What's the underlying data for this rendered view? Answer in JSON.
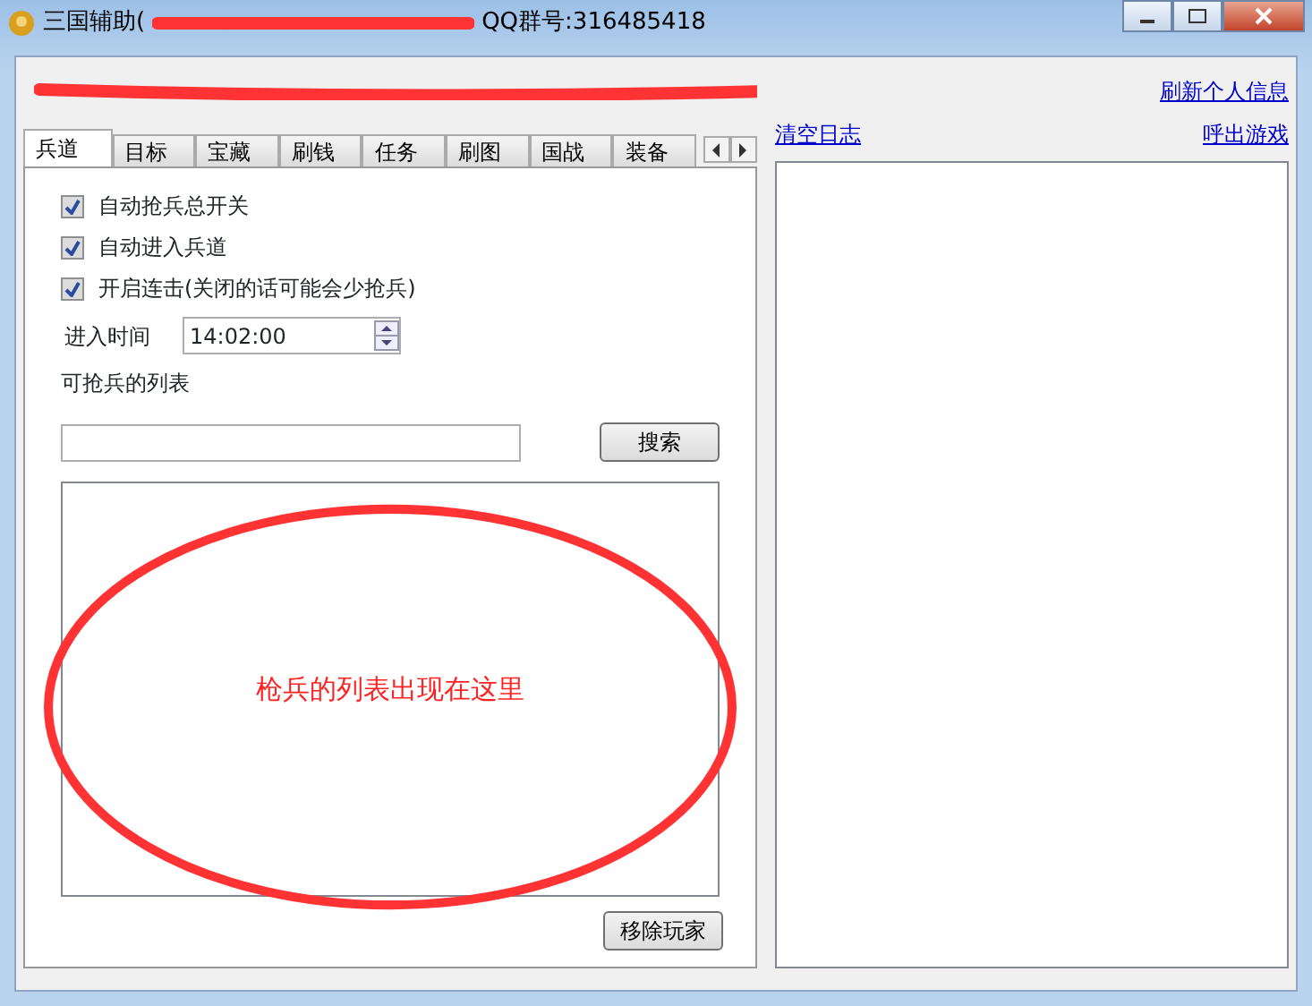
{
  "window": {
    "title": "三国辅助(",
    "title_suffix": "QQ群号:316485418"
  },
  "links": [
    "刷新个人信息",
    "清空日志",
    "呼出游戏"
  ],
  "tabs": [
    {
      "label": "兵道",
      "selected": true
    },
    {
      "label": "目标",
      "selected": false
    },
    {
      "label": "宝藏",
      "selected": false
    },
    {
      "label": "刷钱",
      "selected": false
    },
    {
      "label": "任务",
      "selected": false
    },
    {
      "label": "刷图",
      "selected": false
    },
    {
      "label": "国战",
      "selected": false
    },
    {
      "label": "装备",
      "selected": false
    }
  ],
  "checkboxes": [
    {
      "label": "自动抢兵总开关",
      "checked": true
    },
    {
      "label": "自动进入兵道",
      "checked": true
    },
    {
      "label": "开启连击(关闭的话可能会少抢兵)",
      "checked": true
    }
  ],
  "time": {
    "label": "进入时间",
    "value": "14:02:00"
  },
  "list_label": "可抢兵的列表",
  "search_button": "搜索",
  "annotation": "枪兵的列表出现在这里",
  "remove_button": "移除玩家"
}
